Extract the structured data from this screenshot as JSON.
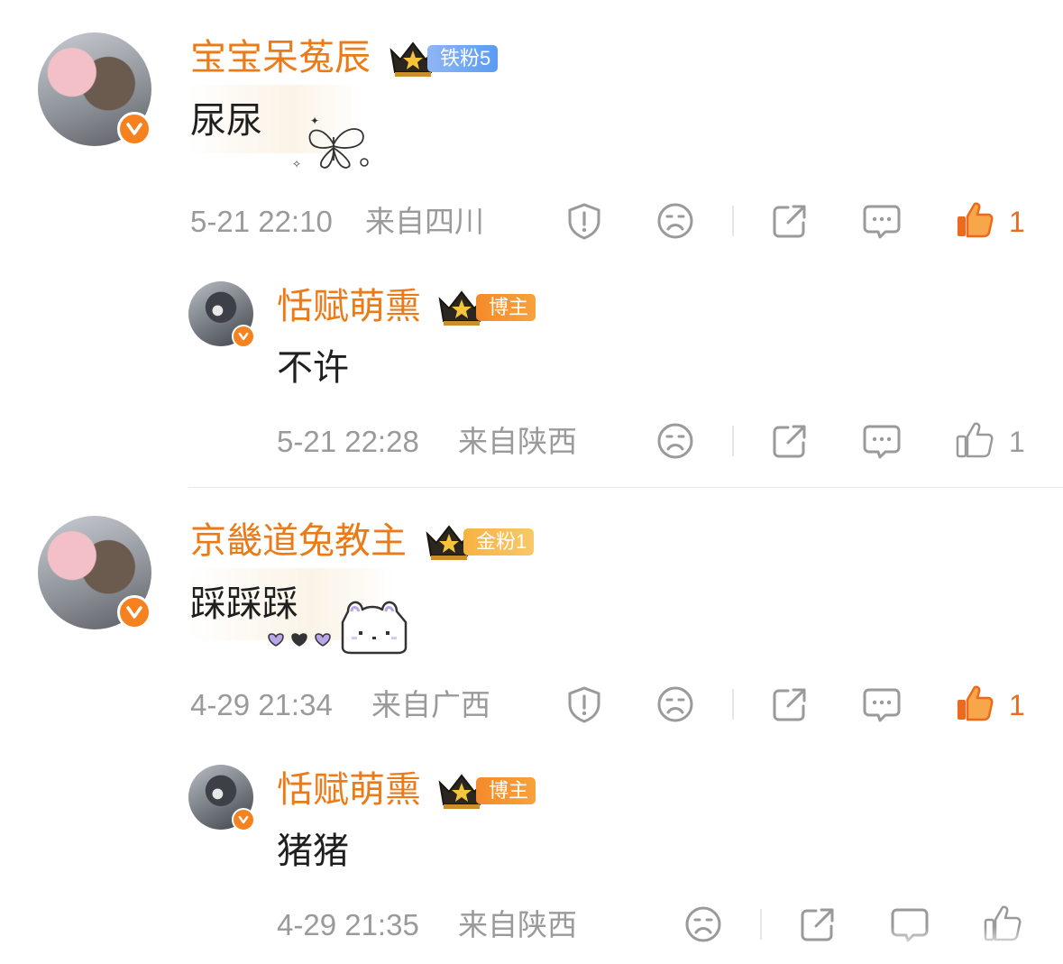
{
  "comments": [
    {
      "author": "宝宝呆菟辰",
      "fan_badge": "铁粉5",
      "text": "尿尿",
      "time": "5-21 22:10",
      "location": "来自四川",
      "likes": "1",
      "reply": {
        "author": "恬赋萌熏",
        "fan_badge": "博主",
        "text": "不许",
        "time": "5-21 22:28",
        "location": "来自陕西",
        "likes": "1"
      }
    },
    {
      "author": "京畿道兔教主",
      "fan_badge": "金粉1",
      "text": "踩踩踩",
      "time": "4-29 21:34",
      "location": "来自广西",
      "likes": "1",
      "reply": {
        "author": "恬赋萌熏",
        "fan_badge": "博主",
        "text": "猪猪",
        "time": "4-29 21:35",
        "location": "来自陕西"
      }
    }
  ],
  "colors": {
    "name": "#eb7a18",
    "like_active": "#eb6a1d",
    "meta": "#9a9a9a",
    "icon": "#9a9a9a"
  },
  "icons": [
    "shield-alert-icon",
    "sad-face-icon",
    "share-icon",
    "comment-icon",
    "thumbs-up-icon",
    "verified-v-icon",
    "crown-icon",
    "butterfly-sticker",
    "bunny-sticker"
  ]
}
